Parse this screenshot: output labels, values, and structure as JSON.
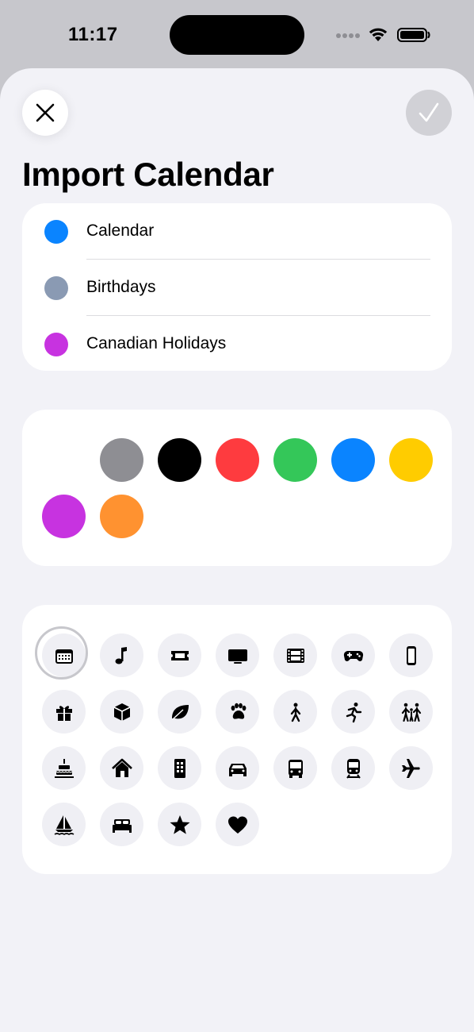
{
  "status_bar": {
    "time": "11:17"
  },
  "header": {
    "title": "Import Calendar"
  },
  "calendars": [
    {
      "label": "Calendar",
      "color": "#0a84ff"
    },
    {
      "label": "Birthdays",
      "color": "#8a9ab3"
    },
    {
      "label": "Canadian Holidays",
      "color": "#c733e0"
    }
  ],
  "colors": [
    "#8e8e93",
    "#000000",
    "#fe3b3f",
    "#34c759",
    "#0a84ff",
    "#ffcc00",
    "#c733e0",
    "#ff9230"
  ],
  "icons": [
    "calendar-icon",
    "music-note-icon",
    "ticket-icon",
    "tv-icon",
    "film-icon",
    "gamecontroller-icon",
    "iphone-icon",
    "gift-icon",
    "shipping-box-icon",
    "leaf-icon",
    "pawprint-icon",
    "walking-figure-icon",
    "running-figure-icon",
    "family-icon",
    "birthday-cake-icon",
    "house-icon",
    "building-icon",
    "car-icon",
    "bus-icon",
    "tram-icon",
    "airplane-icon",
    "sailboat-icon",
    "bed-icon",
    "star-icon",
    "heart-icon"
  ],
  "selected_icon": "calendar-icon",
  "colors_meta": {
    "accent_blue": "#0a84ff",
    "sheet_background": "#f2f2f7"
  }
}
